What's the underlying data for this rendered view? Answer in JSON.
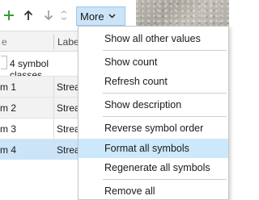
{
  "toolbar": {
    "more_label": "More",
    "icons": [
      "plus-icon",
      "arrow-up-icon",
      "arrow-down-icon",
      "sort-icon",
      "chevron-down-icon"
    ]
  },
  "grid": {
    "header_partial": "e",
    "header_label": "Labe",
    "class_count": "4 symbol classes",
    "rows": [
      {
        "c1": "m 1",
        "c2": "Strea"
      },
      {
        "c1": "m 2",
        "c2": "Strea"
      },
      {
        "c1": "m 3",
        "c2": "Strea"
      },
      {
        "c1": "m 4",
        "c2": "Strea"
      }
    ]
  },
  "menu": {
    "items": [
      "Show all other values",
      "Show count",
      "Refresh count",
      "Show description",
      "Reverse symbol order",
      "Format all symbols",
      "Regenerate all symbols",
      "Remove all"
    ],
    "highlighted": "Format all symbols"
  },
  "colors": {
    "accent_light": "#cce4f7",
    "accent_border": "#99c9ef",
    "plus_green": "#3a9a3a"
  }
}
